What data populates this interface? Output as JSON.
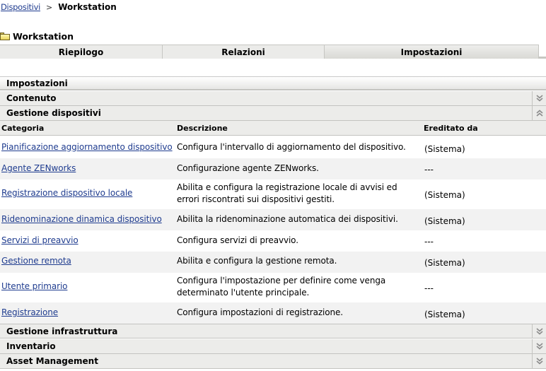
{
  "breadcrumb": {
    "parent": "Dispositivi",
    "separator": ">",
    "current": "Workstation"
  },
  "page": {
    "title": "Workstation",
    "icon": "folder-icon"
  },
  "tabs": [
    {
      "label": "Riepilogo",
      "active": false
    },
    {
      "label": "Relazioni",
      "active": false
    },
    {
      "label": "Impostazioni",
      "active": true
    }
  ],
  "settings": {
    "header": "Impostazioni",
    "sections": [
      {
        "label": "Contenuto",
        "expanded": false,
        "icon": "chevron-double-down-icon"
      },
      {
        "label": "Gestione dispositivi",
        "expanded": true,
        "icon": "chevron-double-up-icon"
      },
      {
        "label": "Gestione infrastruttura",
        "expanded": false,
        "icon": "chevron-double-down-icon"
      },
      {
        "label": "Inventario",
        "expanded": false,
        "icon": "chevron-double-down-icon"
      },
      {
        "label": "Asset Management",
        "expanded": false,
        "icon": "chevron-double-down-icon"
      }
    ],
    "table": {
      "columns": [
        "Categoria",
        "Descrizione",
        "Ereditato da"
      ],
      "rows": [
        {
          "category": "Pianificazione aggiornamento dispositivo",
          "description": "Configura l'intervallo di aggiornamento del dispositivo.",
          "inherited": "(Sistema)"
        },
        {
          "category": "Agente ZENworks",
          "description": "Configurazione agente ZENworks.",
          "inherited": "---"
        },
        {
          "category": "Registrazione dispositivo locale",
          "description": "Abilita e configura la registrazione locale di avvisi ed errori riscontrati sui dispositivi gestiti.",
          "inherited": "(Sistema)"
        },
        {
          "category": "Ridenominazione dinamica dispositivo",
          "description": "Abilita la ridenominazione automatica dei dispositivi.",
          "inherited": "(Sistema)"
        },
        {
          "category": "Servizi di preavvio",
          "description": "Configura servizi di preavvio.",
          "inherited": "---"
        },
        {
          "category": "Gestione remota",
          "description": "Abilita e configura la gestione remota.",
          "inherited": "(Sistema)"
        },
        {
          "category": "Utente primario",
          "description": "Configura l'impostazione per definire come venga determinato l'utente principale.",
          "inherited": "---"
        },
        {
          "category": "Registrazione",
          "description": "Configura impostazioni di registrazione.",
          "inherited": "(Sistema)"
        }
      ]
    }
  }
}
